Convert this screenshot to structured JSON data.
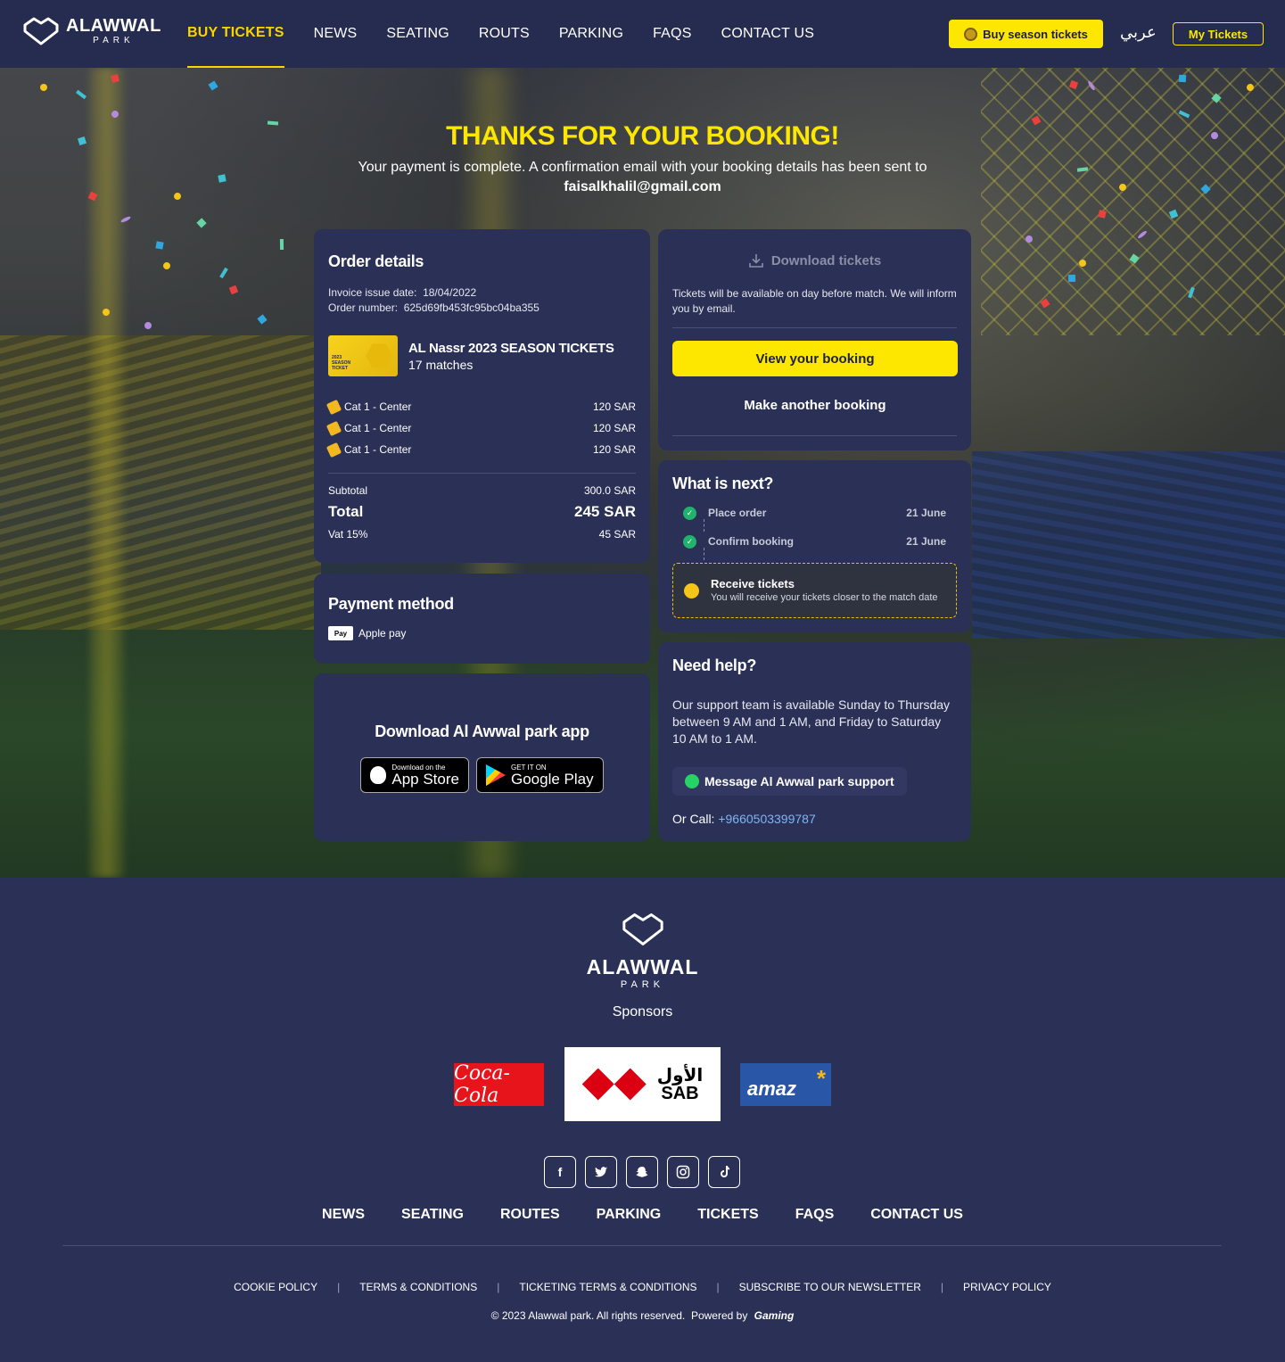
{
  "header": {
    "logo_main": "ALAWWAL",
    "logo_sub": "PARK",
    "nav": [
      "BUY TICKETS",
      "NEWS",
      "SEATING",
      "ROUTS",
      "PARKING",
      "FAQS",
      "CONTACT US"
    ],
    "season_button": "Buy season tickets",
    "language": "عربي",
    "my_tickets": "My Tickets"
  },
  "hero": {
    "title": "THANKS FOR YOUR BOOKING!",
    "subtitle": "Your payment is complete. A confirmation email with your booking details has been sent to",
    "email": "faisalkhalil@gmail.com"
  },
  "order": {
    "title": "Order details",
    "invoice_label": "Invoice issue date:",
    "invoice_date": "18/04/2022",
    "order_label": "Order number:",
    "order_number": "625d69fb453fc95bc04ba355",
    "product_title": "AL Nassr 2023 SEASON TICKETS",
    "product_sub": "17 matches",
    "ticket_img_text": "2023 SEASON TICKET",
    "lines": [
      {
        "label": "Cat 1 - Center",
        "price": "120 SAR"
      },
      {
        "label": "Cat 1 - Center",
        "price": "120 SAR"
      },
      {
        "label": "Cat 1 - Center",
        "price": "120 SAR"
      }
    ],
    "subtotal_label": "Subtotal",
    "subtotal": "300.0 SAR",
    "total_label": "Total",
    "total": "245 SAR",
    "vat_label": "Vat 15%",
    "vat": "45 SAR"
  },
  "payment": {
    "title": "Payment method",
    "badge": "Pay",
    "method": "Apple pay"
  },
  "app": {
    "title": "Download Al Awwal park app",
    "appstore_small": "Download on the",
    "appstore_big": "App Store",
    "gplay_small": "GET IT ON",
    "gplay_big": "Google Play"
  },
  "download": {
    "title": "Download tickets",
    "note": "Tickets will be available on day before match. We will inform you by email.",
    "view_booking": "View your booking",
    "another_booking": "Make another booking"
  },
  "next": {
    "title": "What is next?",
    "steps": [
      {
        "label": "Place order",
        "date": "21 June"
      },
      {
        "label": "Confirm booking",
        "date": "21 June"
      }
    ],
    "receive_title": "Receive tickets",
    "receive_sub": "You will receive your tickets closer to the match date"
  },
  "help": {
    "title": "Need help?",
    "text": "Our support team is available Sunday to Thursday between 9 AM and 1 AM, and Friday to Saturday 10 AM to 1 AM.",
    "whatsapp": "Message Al Awwal park support",
    "call_label": "Or Call:",
    "phone": "+9660503399787"
  },
  "footer": {
    "logo_main": "ALAWWAL",
    "logo_sub": "PARK",
    "sponsors_label": "Sponsors",
    "sponsor_coke": "Coca-Cola",
    "sponsor_sab_ar": "الأول",
    "sponsor_sab": "SAB",
    "sponsor_amaz": "amaz",
    "socials": [
      "f",
      "t",
      "s",
      "ig",
      "tt"
    ],
    "nav": [
      "NEWS",
      "SEATING",
      "ROUTES",
      "PARKING",
      "TICKETS",
      "FAQS",
      "CONTACT US"
    ],
    "links": [
      "COOKIE POLICY",
      "TERMS & CONDITIONS",
      "TICKETING TERMS & CONDITIONS",
      "SUBSCRIBE TO OUR NEWSLETTER",
      "PRIVACY POLICY"
    ],
    "copyright": "© 2023 Alawwal park. All rights reserved.",
    "powered_label": "Powered by",
    "powered_brand": "Gaming"
  },
  "colors": {
    "accent": "#fde600",
    "panel": "#2b3156",
    "header": "#262c4f",
    "link": "#7fb4f5"
  }
}
